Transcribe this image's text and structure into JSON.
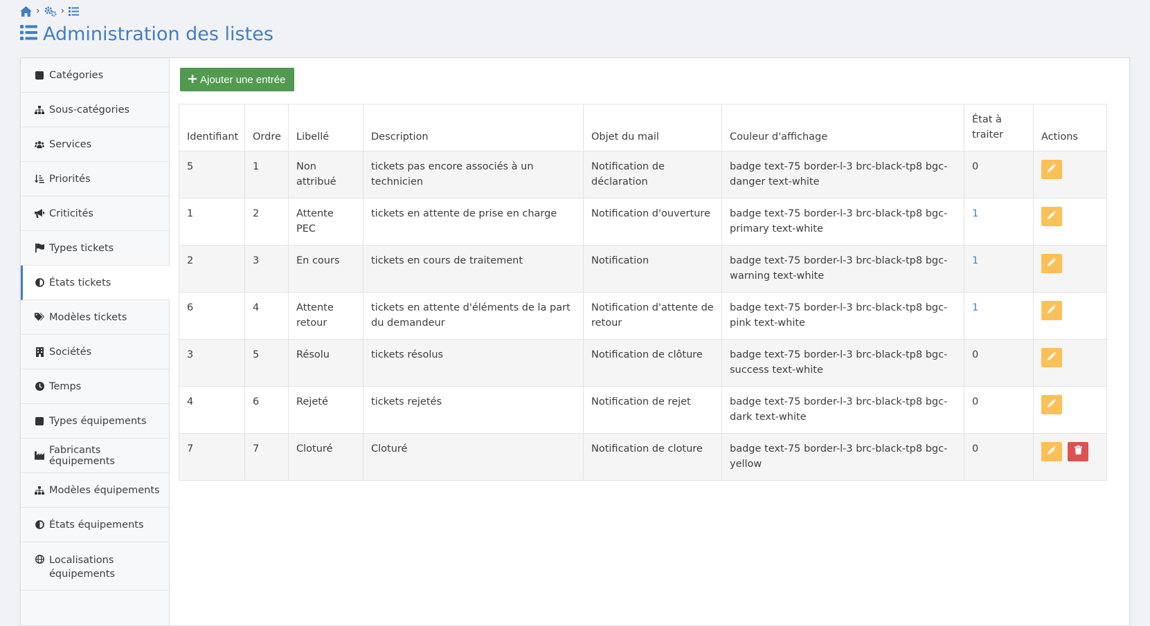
{
  "page": {
    "title": "Administration des listes"
  },
  "breadcrumb": {
    "sep": "›"
  },
  "colors": {
    "accent": "#3f7fc5",
    "add_button": "#519a4f",
    "edit_button": "#fdc056",
    "delete_button": "#d9534f"
  },
  "sidebar": {
    "items": [
      {
        "label": "Catégories",
        "icon": "square-icon"
      },
      {
        "label": "Sous-catégories",
        "icon": "sitemap-icon"
      },
      {
        "label": "Services",
        "icon": "users-icon"
      },
      {
        "label": "Priorités",
        "icon": "sort-amount-icon"
      },
      {
        "label": "Criticités",
        "icon": "bullhorn-icon"
      },
      {
        "label": "Types tickets",
        "icon": "flag-icon"
      },
      {
        "label": "États tickets",
        "icon": "adjust-icon",
        "active": true
      },
      {
        "label": "Modèles tickets",
        "icon": "tags-icon"
      },
      {
        "label": "Sociétés",
        "icon": "building-icon"
      },
      {
        "label": "Temps",
        "icon": "clock-icon"
      },
      {
        "label": "Types équipements",
        "icon": "square-icon"
      },
      {
        "label": "Fabricants équipements",
        "icon": "industry-icon"
      },
      {
        "label": "Modèles équipements",
        "icon": "sitemap-icon"
      },
      {
        "label": "États équipements",
        "icon": "adjust-icon"
      },
      {
        "label": "Localisations équipements",
        "icon": "globe-icon"
      }
    ]
  },
  "toolbar": {
    "add_label": "Ajouter une entrée"
  },
  "table": {
    "columns": [
      "Identifiant",
      "Ordre",
      "Libellé",
      "Description",
      "Objet du mail",
      "Couleur d'affichage",
      "État à traiter",
      "Actions"
    ],
    "rows": [
      {
        "id": "5",
        "ordre": "1",
        "libelle": "Non attribué",
        "description": "tickets pas encore associés à un technicien",
        "objet": "Notification de déclaration",
        "couleur": "badge text-75 border-l-3 brc-black-tp8 bgc-danger text-white",
        "etat": "0",
        "deletable": false
      },
      {
        "id": "1",
        "ordre": "2",
        "libelle": "Attente PEC",
        "description": "tickets en attente de prise en charge",
        "objet": "Notification d'ouverture",
        "couleur": "badge text-75 border-l-3 brc-black-tp8 bgc-primary text-white",
        "etat": "1",
        "deletable": false
      },
      {
        "id": "2",
        "ordre": "3",
        "libelle": "En cours",
        "description": "tickets en cours de traitement",
        "objet": "Notification",
        "couleur": "badge text-75 border-l-3 brc-black-tp8 bgc-warning text-white",
        "etat": "1",
        "deletable": false
      },
      {
        "id": "6",
        "ordre": "4",
        "libelle": "Attente retour",
        "description": "tickets en attente d'éléments de la part du demandeur",
        "objet": "Notification d'attente de retour",
        "couleur": "badge text-75 border-l-3 brc-black-tp8 bgc-pink text-white",
        "etat": "1",
        "deletable": false
      },
      {
        "id": "3",
        "ordre": "5",
        "libelle": "Résolu",
        "description": "tickets résolus",
        "objet": "Notification de clôture",
        "couleur": "badge text-75 border-l-3 brc-black-tp8 bgc-success text-white",
        "etat": "0",
        "deletable": false
      },
      {
        "id": "4",
        "ordre": "6",
        "libelle": "Rejeté",
        "description": "tickets rejetés",
        "objet": "Notification de rejet",
        "couleur": "badge text-75 border-l-3 brc-black-tp8 bgc-dark text-white",
        "etat": "0",
        "deletable": false
      },
      {
        "id": "7",
        "ordre": "7",
        "libelle": "Cloturé",
        "description": "Cloturé",
        "objet": "Notification de cloture",
        "couleur": "badge text-75 border-l-3 brc-black-tp8 bgc-yellow",
        "etat": "0",
        "deletable": true
      }
    ]
  }
}
